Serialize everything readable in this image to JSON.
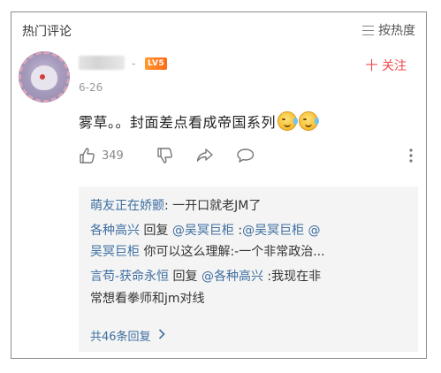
{
  "header": {
    "title": "热门评论",
    "sort_label": "按热度"
  },
  "comment": {
    "separator": "-",
    "level_badge": "LV5",
    "follow_label": "十 关注",
    "date": "6-26",
    "text": "雾草。。封面差点看成帝国系列",
    "emoji_count": 2,
    "like_count": "349"
  },
  "replies": {
    "lines": [
      {
        "parts": [
          {
            "text": "萌友正在娇颤",
            "link": true
          },
          {
            "text": ": 一开口就老JM了",
            "link": false
          }
        ]
      },
      {
        "parts": [
          {
            "text": "各种高兴",
            "link": true
          },
          {
            "text": " 回复 ",
            "link": false
          },
          {
            "text": "@吴冥巨柜",
            "link": true
          },
          {
            "text": " :",
            "link": false
          },
          {
            "text": "@吴冥巨柜",
            "link": true
          },
          {
            "text": " ",
            "link": false
          },
          {
            "text": "@",
            "link": true
          }
        ]
      },
      {
        "parts": [
          {
            "text": "吴冥巨柜",
            "link": true
          },
          {
            "text": " 你可以这么理解:-一个非常政治...",
            "link": false
          }
        ]
      },
      {
        "parts": [
          {
            "text": "言苟-获命永恒",
            "link": true
          },
          {
            "text": " 回复 ",
            "link": false
          },
          {
            "text": "@各种高兴",
            "link": true
          },
          {
            "text": " :我现在非",
            "link": false
          }
        ]
      },
      {
        "parts": [
          {
            "text": "常想看拳师和jm对线",
            "link": false
          }
        ]
      }
    ],
    "more_label": "共46条回复"
  },
  "colors": {
    "link": "#3e6ea0",
    "follow": "#ef4b4b",
    "badge": "#ff7a22",
    "reply_bg": "#f4f4f4"
  },
  "icons": [
    "menu-icon",
    "thumbs-up-icon",
    "thumbs-down-icon",
    "share-icon",
    "comment-bubble-icon",
    "more-vertical-icon",
    "chevron-right-icon"
  ]
}
